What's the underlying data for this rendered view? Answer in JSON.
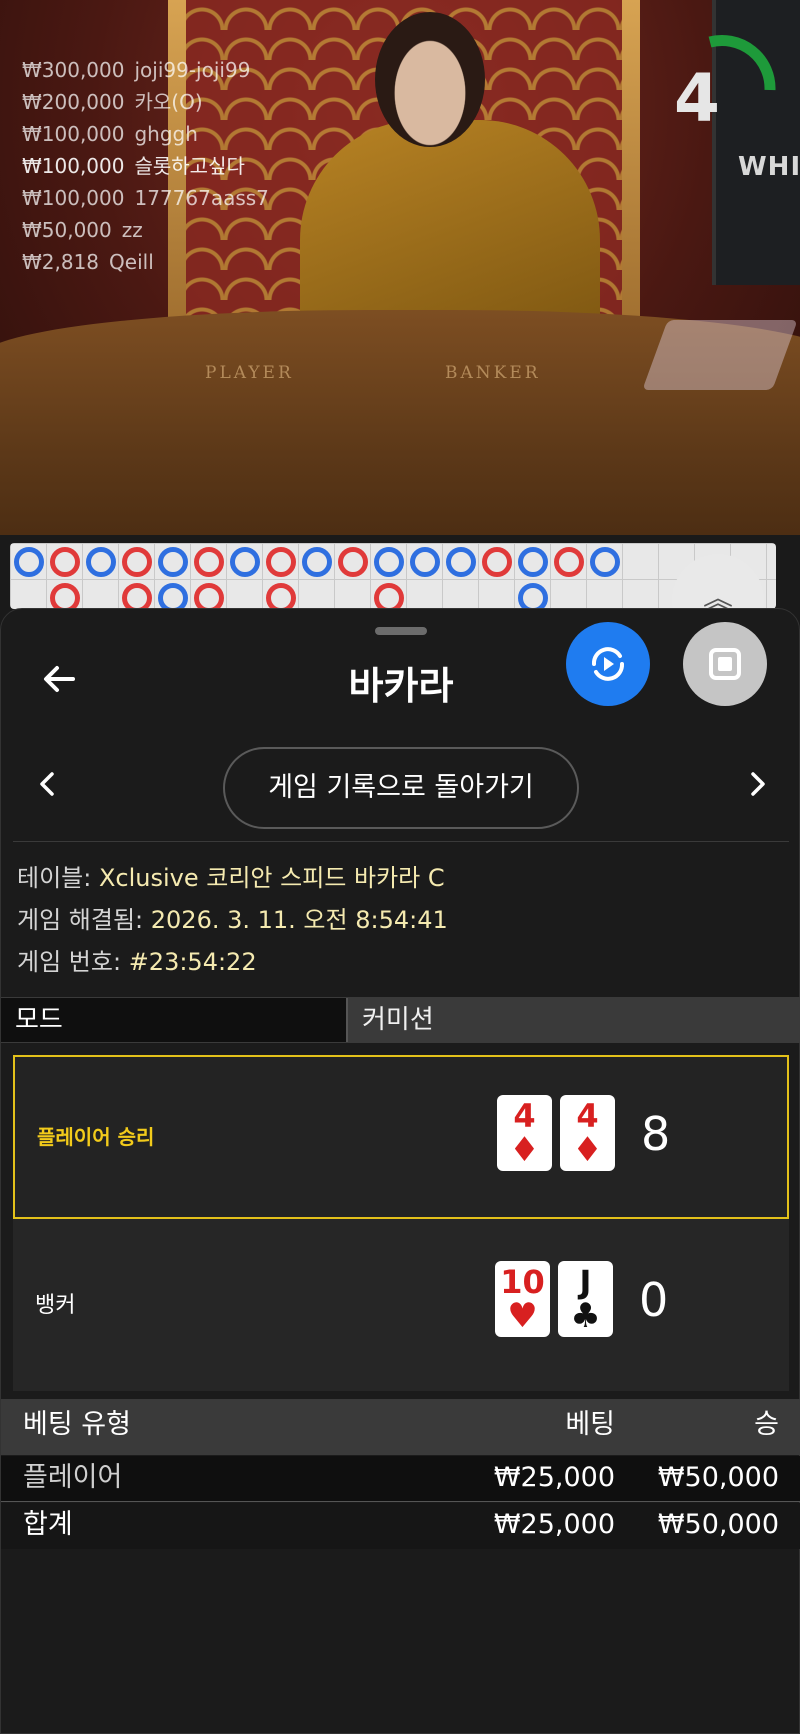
{
  "stage": {
    "timer": "4",
    "table_labels": {
      "player": "PLAYER",
      "banker": "BANKER"
    },
    "monitor_text": "WHIT",
    "winners": [
      {
        "amount": "₩300,000",
        "name": "joji99-joji99"
      },
      {
        "amount": "₩200,000",
        "name": "카오(O)"
      },
      {
        "amount": "₩100,000",
        "name": "ghggh"
      },
      {
        "amount": "₩100,000",
        "name": "슬롯하고싶다"
      },
      {
        "amount": "₩100,000",
        "name": "177767aass7"
      },
      {
        "amount": "₩50,000",
        "name": "zz"
      },
      {
        "amount": "₩2,818",
        "name": "Qeill"
      }
    ]
  },
  "sheet": {
    "title": "바카라",
    "back_icon": "arrow-left-icon",
    "replay_icon": "replay-icon",
    "stop_icon": "stop-icon",
    "history_button": "게임 기록으로 돌아가기",
    "info": {
      "table_label": "테이블:",
      "table_value": "Xclusive 코리안 스피드 바카라 C",
      "resolved_label": "게임 해결됨:",
      "resolved_value": "2026. 3. 11. 오전 8:54:41",
      "number_label": "게임 번호:",
      "number_value": "#23:54:22"
    },
    "tabs": {
      "mode": "모드",
      "commission": "커미션"
    },
    "results": {
      "player": {
        "label": "플레이어 승리",
        "score": "8",
        "cards": [
          {
            "rank": "4",
            "suit": "♦"
          },
          {
            "rank": "4",
            "suit": "♦"
          }
        ]
      },
      "banker": {
        "label": "뱅커",
        "score": "0",
        "cards": [
          {
            "rank": "10",
            "suit": "♥"
          },
          {
            "rank": "J",
            "suit": "♣"
          }
        ]
      }
    },
    "bets": {
      "headers": {
        "type": "베팅 유형",
        "bet": "베팅",
        "win": "승"
      },
      "rows": [
        {
          "type": "플레이어",
          "bet": "₩25,000",
          "win": "₩50,000"
        }
      ],
      "total": {
        "type": "합계",
        "bet": "₩25,000",
        "win": "₩50,000"
      }
    }
  },
  "colors": {
    "accent_blue": "#1f7cf0",
    "win_highlight": "#e3c11a",
    "info_value": "#f5eab0"
  }
}
